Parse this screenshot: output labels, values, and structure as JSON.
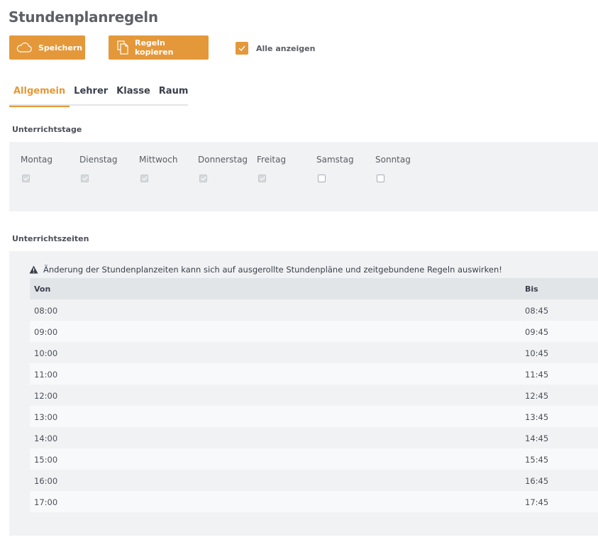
{
  "page": {
    "title": "Stundenplanregeln"
  },
  "toolbar": {
    "save_label": "Speichern",
    "save_icon": "cloud-icon",
    "copy_label": "Regeln kopieren",
    "copy_icon": "copy-icon",
    "show_all_label": "Alle anzeigen",
    "show_all_checked": true
  },
  "tabs": [
    {
      "label": "Allgemein",
      "active": true
    },
    {
      "label": "Lehrer",
      "active": false
    },
    {
      "label": "Klasse",
      "active": false
    },
    {
      "label": "Raum",
      "active": false
    }
  ],
  "teaching_days": {
    "title": "Unterrichtstage",
    "days": [
      {
        "label": "Montag",
        "checked": true
      },
      {
        "label": "Dienstag",
        "checked": true
      },
      {
        "label": "Mittwoch",
        "checked": true
      },
      {
        "label": "Donnerstag",
        "checked": true
      },
      {
        "label": "Freitag",
        "checked": true
      },
      {
        "label": "Samstag",
        "checked": false
      },
      {
        "label": "Sonntag",
        "checked": false
      }
    ]
  },
  "teaching_times": {
    "title": "Unterrichtszeiten",
    "warning": "Änderung der Stundenplanzeiten kann sich auf ausgerollte Stundenpläne und zeitgebundene Regeln auswirken!",
    "columns": {
      "from": "Von",
      "to": "Bis"
    },
    "rows": [
      {
        "from": "08:00",
        "to": "08:45"
      },
      {
        "from": "09:00",
        "to": "09:45"
      },
      {
        "from": "10:00",
        "to": "10:45"
      },
      {
        "from": "11:00",
        "to": "11:45"
      },
      {
        "from": "12:00",
        "to": "12:45"
      },
      {
        "from": "13:00",
        "to": "13:45"
      },
      {
        "from": "14:00",
        "to": "14:45"
      },
      {
        "from": "15:00",
        "to": "15:45"
      },
      {
        "from": "16:00",
        "to": "16:45"
      },
      {
        "from": "17:00",
        "to": "17:45"
      }
    ]
  },
  "colors": {
    "accent": "#e4983a",
    "panel": "#f0f2f3",
    "header_row": "#e2e5e8"
  }
}
